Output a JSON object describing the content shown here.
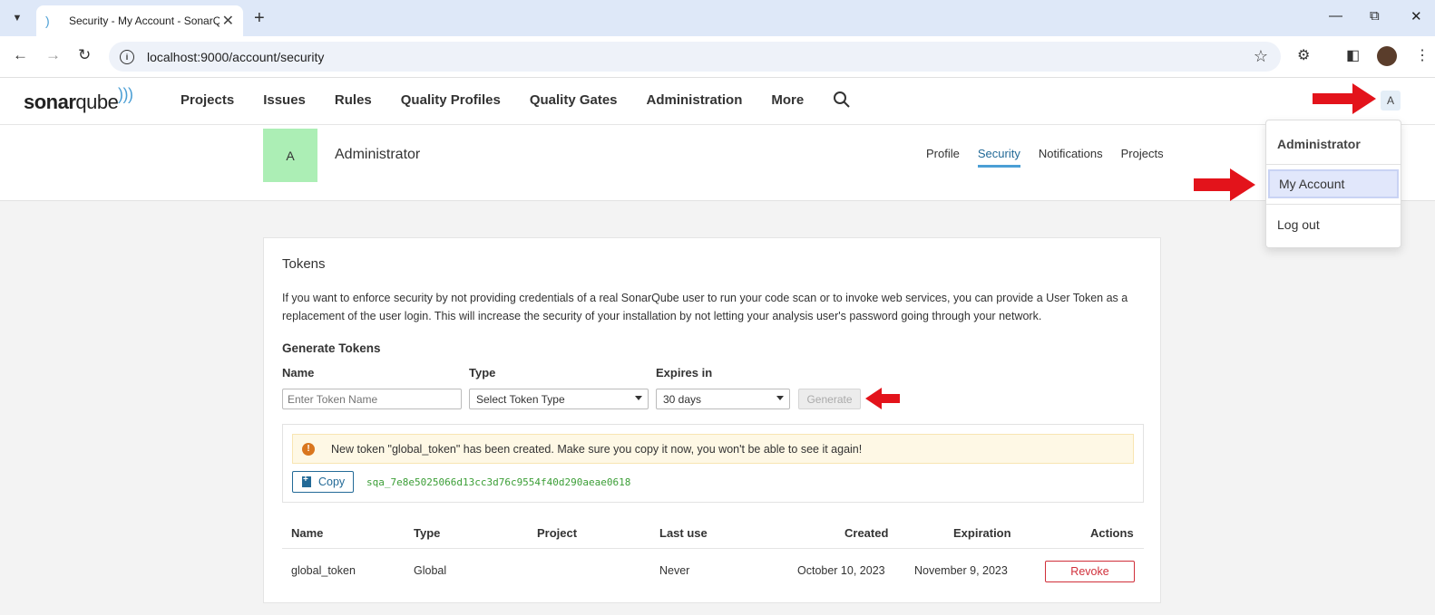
{
  "browser": {
    "tab_title": "Security - My Account - SonarQube",
    "url": "localhost:9000/account/security"
  },
  "nav": {
    "logo_part1": "sonar",
    "logo_part2": "qube",
    "items": [
      "Projects",
      "Issues",
      "Rules",
      "Quality Profiles",
      "Quality Gates",
      "Administration",
      "More"
    ],
    "user_initial": "A"
  },
  "account": {
    "avatar_initial": "A",
    "name": "Administrator",
    "tabs": [
      "Profile",
      "Security",
      "Notifications",
      "Projects"
    ],
    "active_tab": "Security"
  },
  "tokens": {
    "title": "Tokens",
    "description": "If you want to enforce security by not providing credentials of a real SonarQube user to run your code scan or to invoke web services, you can provide a User Token as a replacement of the user login. This will increase the security of your installation by not letting your analysis user's password going through your network.",
    "generate_title": "Generate Tokens",
    "name_label": "Name",
    "type_label": "Type",
    "expires_label": "Expires in",
    "name_placeholder": "Enter Token Name",
    "type_value": "Select Token Type",
    "expires_value": "30 days",
    "generate_label": "Generate",
    "alert_text": "New token \"global_token\" has been created. Make sure you copy it now, you won't be able to see it again!",
    "copy_label": "Copy",
    "token_value": "sqa_7e8e5025066d13cc3d76c9554f40d290aeae0618",
    "table": {
      "headers": [
        "Name",
        "Type",
        "Project",
        "Last use",
        "Created",
        "Expiration",
        "Actions"
      ],
      "rows": [
        {
          "name": "global_token",
          "type": "Global",
          "project": "",
          "last_use": "Never",
          "created": "October 10, 2023",
          "expiration": "November 9, 2023",
          "action": "Revoke"
        }
      ]
    }
  },
  "dropdown": {
    "header": "Administrator",
    "items": [
      "My Account",
      "Log out"
    ]
  },
  "colors": {
    "accent": "#4b9fd5",
    "avatar_bg": "#aceeb5",
    "annotation_arrow": "#e3131b",
    "revoke": "#d02f3a"
  }
}
